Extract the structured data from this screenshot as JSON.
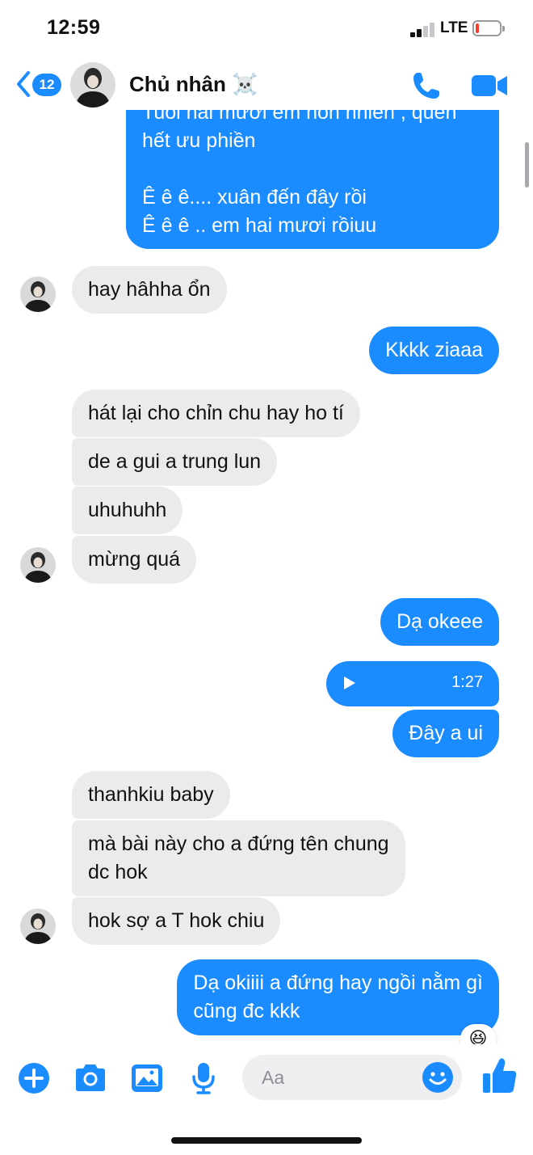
{
  "status_bar": {
    "time": "12:59",
    "network": "LTE",
    "signal_bars_active": 2,
    "signal_bars_total": 4,
    "battery_level": 0.15,
    "battery_color": "#ff3b30"
  },
  "header": {
    "back_badge": "12",
    "contact_name": "Chủ nhân ☠️",
    "accent_color": "#1a8cff",
    "icons": [
      "chevron-left-icon",
      "phone-icon",
      "video-camera-icon"
    ]
  },
  "messages": [
    {
      "id": "m1",
      "direction": "outgoing",
      "lines": [
        "Tuổi hai mươi em hồn nhiên , quên",
        "hết ưu phiền",
        "",
        "Ê ê ê.... xuân đến đây rồi",
        "Ê ê ê .. em hai mươi rồiuu"
      ]
    },
    {
      "id": "m2",
      "direction": "incoming",
      "text": "hay hâhha ổn",
      "show_avatar": true
    },
    {
      "id": "m3",
      "direction": "outgoing",
      "text": "Kkkk ziaaa"
    },
    {
      "id": "m4",
      "direction": "incoming",
      "text": "hát lại cho chỉn chu hay ho tí"
    },
    {
      "id": "m5",
      "direction": "incoming",
      "text": "de a gui a trung lun"
    },
    {
      "id": "m6",
      "direction": "incoming",
      "text": "uhuhuhh"
    },
    {
      "id": "m7",
      "direction": "incoming",
      "text": "mừng quá",
      "show_avatar": true
    },
    {
      "id": "m8",
      "direction": "outgoing",
      "text": "Dạ okeee"
    },
    {
      "id": "m9",
      "direction": "outgoing",
      "type": "audio",
      "duration": "1:27"
    },
    {
      "id": "m10",
      "direction": "outgoing",
      "text": "Đây a ui"
    },
    {
      "id": "m11",
      "direction": "incoming",
      "text": "thanhkiu baby"
    },
    {
      "id": "m12",
      "direction": "incoming",
      "lines": [
        "mà bài này cho a đứng tên chung",
        "dc hok"
      ]
    },
    {
      "id": "m13",
      "direction": "incoming",
      "text": "hok sợ a T hok chiu",
      "show_avatar": true
    },
    {
      "id": "m14",
      "direction": "outgoing",
      "lines": [
        "Dạ okiiii a đứng hay ngồi nằm gì",
        "cũng đc kkk"
      ],
      "reaction": "😆"
    }
  ],
  "composer": {
    "placeholder": "Aa",
    "icons": [
      "plus-icon",
      "camera-icon",
      "image-icon",
      "microphone-icon",
      "emoji-icon",
      "thumbs-up-icon"
    ]
  }
}
